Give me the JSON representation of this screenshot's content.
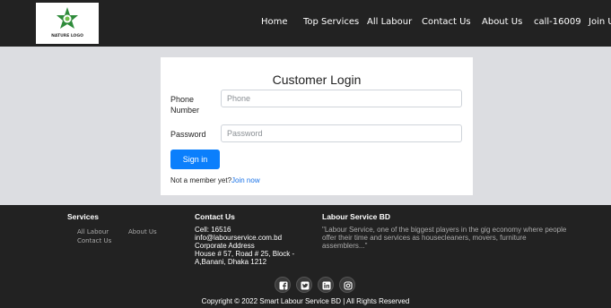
{
  "nav": {
    "logo_text": "NATURE LOGO",
    "links": [
      "Home",
      "Top Services",
      "All Labour",
      "Contact Us",
      "About Us",
      "call-16009",
      "Join Us"
    ]
  },
  "login": {
    "title": "Customer Login",
    "phone_label": "Phone Number",
    "phone_placeholder": "Phone",
    "password_label": "Password",
    "password_placeholder": "Password",
    "signin_label": "Sign in",
    "member_text": "Not a member yet?",
    "join_label": "Join now"
  },
  "footer": {
    "services_heading": "Services",
    "services_links": [
      "All Labour",
      "About Us",
      "Contact Us"
    ],
    "contact_heading": "Contact Us",
    "contact_lines": [
      "Cell: 16516",
      "info@labourservice.com.bd",
      "Corporate Address",
      "House # 57, Road # 25, Block - A,Banani, Dhaka 1212"
    ],
    "about_heading": "Labour Service BD",
    "about_text": "\"Labour Service, one of the biggest players in the gig economy where people offer their time and services as housecleaners, movers, furniture assemblers...\"",
    "socials": [
      "facebook-icon",
      "twitter-icon",
      "linkedin-icon",
      "instagram-icon"
    ],
    "copyright": "Copyright © 2022 Smart Labour Service BD | All Rights Reserved"
  },
  "colors": {
    "nav_bg": "#222222",
    "page_bg": "#dcdde1",
    "primary": "#0b7ffc",
    "link": "#1a73e8",
    "logo_green": "#2e8b3a"
  }
}
